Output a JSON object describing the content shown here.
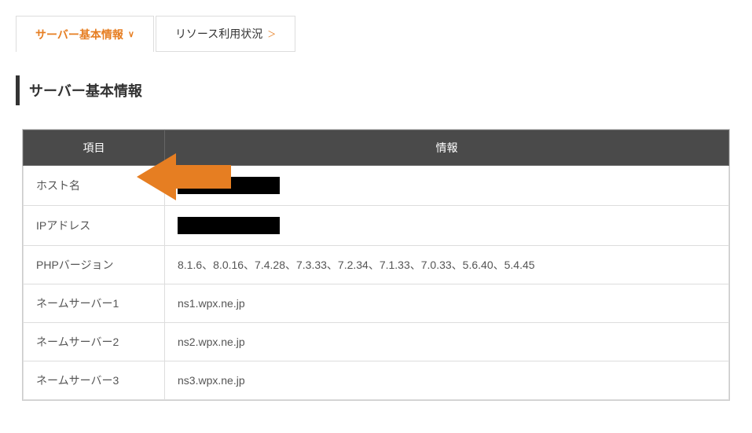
{
  "tabs": {
    "active": "サーバー基本情報",
    "other": "リソース利用状況"
  },
  "sectionTitle": "サーバー基本情報",
  "table": {
    "headers": {
      "item": "項目",
      "info": "情報"
    },
    "rows": [
      {
        "label": "ホスト名",
        "value": "",
        "redacted": true
      },
      {
        "label": "IPアドレス",
        "value": "",
        "redacted": true
      },
      {
        "label": "PHPバージョン",
        "value": "8.1.6、8.0.16、7.4.28、7.3.33、7.2.34、7.1.33、7.0.33、5.6.40、5.4.45",
        "redacted": false
      },
      {
        "label": "ネームサーバー1",
        "value": "ns1.wpx.ne.jp",
        "redacted": false
      },
      {
        "label": "ネームサーバー2",
        "value": "ns2.wpx.ne.jp",
        "redacted": false
      },
      {
        "label": "ネームサーバー3",
        "value": "ns3.wpx.ne.jp",
        "redacted": false
      }
    ]
  },
  "annotation": {
    "color": "#e67e22"
  }
}
